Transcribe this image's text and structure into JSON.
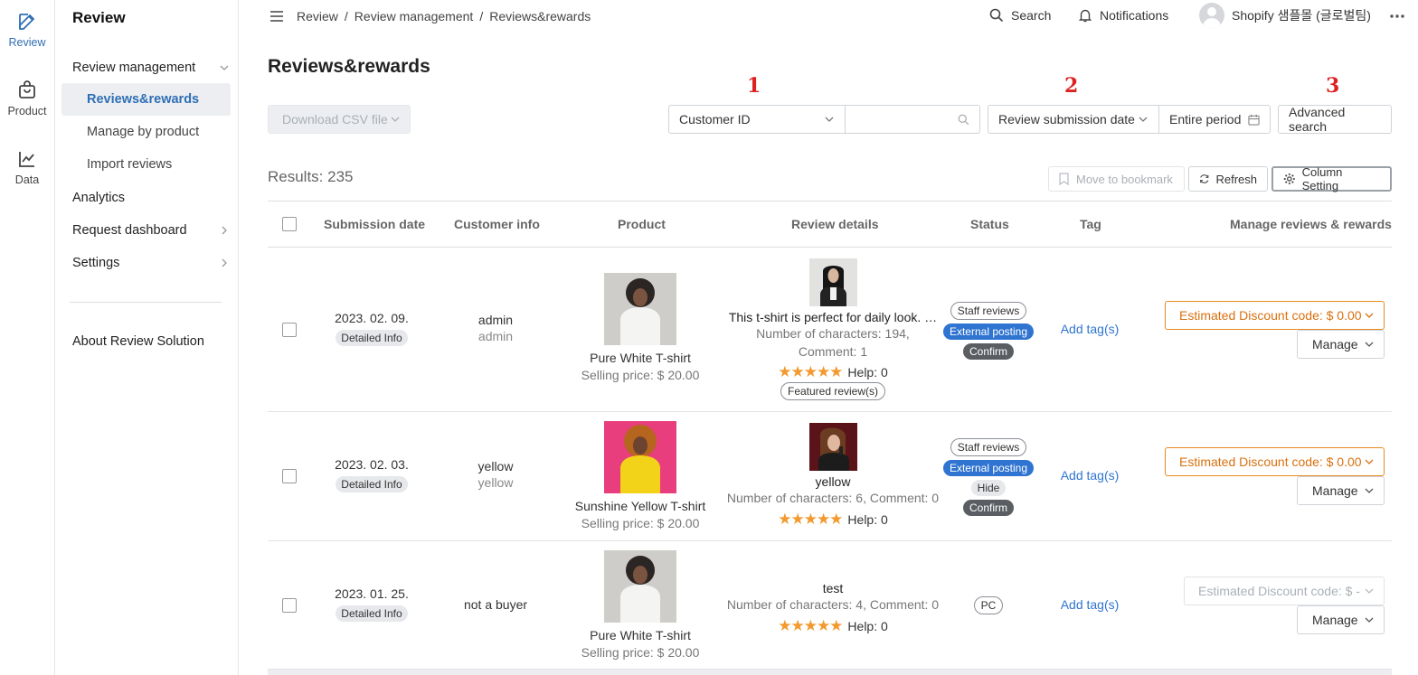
{
  "rail": [
    {
      "label": "Review",
      "icon": "edit-icon"
    },
    {
      "label": "Product",
      "icon": "bag-icon"
    },
    {
      "label": "Data",
      "icon": "chart-icon"
    }
  ],
  "side": {
    "title": "Review",
    "review_management": "Review management",
    "sub": [
      "Reviews&rewards",
      "Manage by product",
      "Import reviews"
    ],
    "analytics": "Analytics",
    "request_dashboard": "Request dashboard",
    "settings": "Settings",
    "about": "About Review Solution"
  },
  "topbar": {
    "breadcrumb": [
      "Review",
      "/",
      "Review management",
      "/",
      "Reviews&rewards"
    ],
    "search": "Search",
    "notifications": "Notifications",
    "store": "Shopify 샘플몰 (글로벌팀)"
  },
  "page": {
    "title": "Reviews&rewards",
    "annotations": [
      "1",
      "2",
      "3"
    ],
    "download_csv": "Download CSV file",
    "filter_field": "Customer ID",
    "search_value": "",
    "date_field": "Review submission date",
    "period": "Entire period",
    "advanced_search": "Advanced search",
    "results": "Results: 235",
    "move_bookmark": "Move to bookmark",
    "refresh": "Refresh",
    "column_setting": "Column Setting"
  },
  "columns": [
    "Submission date",
    "Customer info",
    "Product",
    "Review details",
    "Status",
    "Tag",
    "Manage reviews & rewards"
  ],
  "rows": [
    {
      "date": "2023. 02. 09.",
      "detail_chip": "Detailed Info",
      "customer_name": "admin",
      "customer_id": "admin",
      "product": "Pure White T-shirt",
      "price": "Selling price: $ 20.00",
      "review_text": "This t-shirt is perfect for daily look. …",
      "review_meta": "Number of characters: 194,",
      "review_meta2": "Comment: 1",
      "stars": "★★★★★",
      "help": "Help: 0",
      "featured": "Featured review(s)",
      "statuses": [
        "Staff reviews",
        "External posting",
        "Confirm"
      ],
      "tag": "Add tag(s)",
      "discount": "Estimated Discount code: $ 0.00",
      "manage": "Manage"
    },
    {
      "date": "2023. 02. 03.",
      "detail_chip": "Detailed Info",
      "customer_name": "yellow",
      "customer_id": "yellow",
      "product": "Sunshine Yellow T-shirt",
      "price": "Selling price: $ 20.00",
      "review_text": "yellow",
      "review_meta": "Number of characters: 6, Comment: 0",
      "stars": "★★★★★",
      "help": "Help: 0",
      "statuses": [
        "Staff reviews",
        "External posting",
        "Hide",
        "Confirm"
      ],
      "tag": "Add tag(s)",
      "discount": "Estimated Discount code: $ 0.00",
      "manage": "Manage"
    },
    {
      "date": "2023. 01. 25.",
      "detail_chip": "Detailed Info",
      "customer_name": "not a buyer",
      "product": "Pure White T-shirt",
      "price": "Selling price: $ 20.00",
      "review_text": "test",
      "review_meta": "Number of characters: 4, Comment: 0",
      "stars": "★★★★★",
      "help": "Help: 0",
      "statuses": [
        "PC"
      ],
      "tag": "Add tag(s)",
      "discount": "Estimated Discount code: $ -",
      "manage": "Manage"
    }
  ]
}
